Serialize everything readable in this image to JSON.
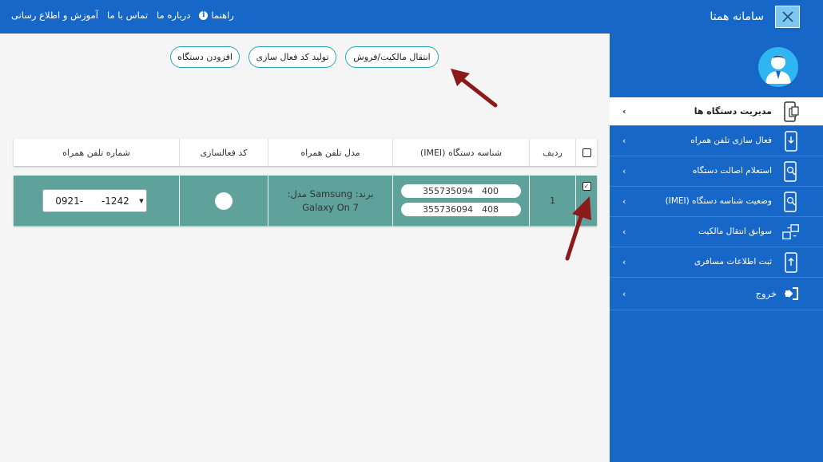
{
  "topbar": {
    "title": "سامانه همتا",
    "nav": [
      "آموزش و اطلاع رسانی",
      "تماس با ما",
      "درباره ما",
      "راهنما"
    ]
  },
  "sidebar": {
    "items": [
      {
        "label": "مدیریت دستگاه ها",
        "icon": "phone-docs-icon",
        "active": true
      },
      {
        "label": "فعال سازی تلفن همراه",
        "icon": "phone-download-icon"
      },
      {
        "label": "استعلام اصالت دستگاه",
        "icon": "phone-search-icon"
      },
      {
        "label": "وضعیت شناسه دستگاه (IMEI)",
        "icon": "phone-search-icon"
      },
      {
        "label": "سوابق انتقال مالکیت",
        "icon": "transfer-icon"
      },
      {
        "label": "ثبت اطلاعات مسافری",
        "icon": "phone-upload-icon"
      },
      {
        "label": "خروج",
        "icon": "exit-icon"
      }
    ]
  },
  "actions": {
    "transfer": "انتقال مالکیت/فروش",
    "generate_code": "تولید کد فعال سازی",
    "add_device": "افزودن دستگاه"
  },
  "table": {
    "headers": {
      "row": "ردیف",
      "imei": "شناسه دستگاه (IMEI)",
      "model": "مدل تلفن همراه",
      "activation": "کد فعالسازی",
      "phone": "شماره تلفن همراه"
    },
    "rows": [
      {
        "index": "1",
        "imei_1_prefix": "355735094",
        "imei_1_suffix": "400",
        "imei_2_prefix": "355736094",
        "imei_2_suffix": "408",
        "model_line1": "برند: Samsung مدل:",
        "model_line2": "Galaxy On 7",
        "phone_value": "0921-      -1242"
      }
    ]
  },
  "colors": {
    "primary": "#1767c8",
    "row_selected": "#5fa29c",
    "button_border": "#2aa6b8",
    "arrow": "#8b1a1a"
  }
}
